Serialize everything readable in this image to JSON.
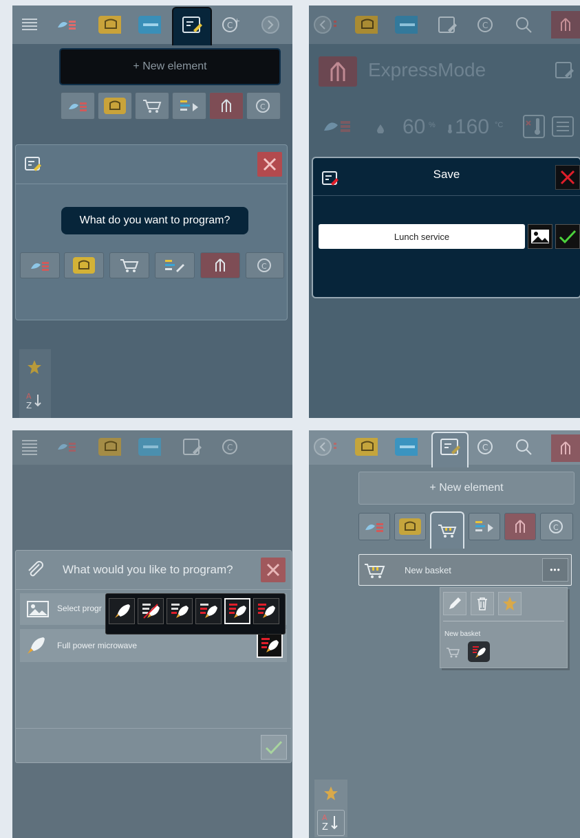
{
  "panel1": {
    "new_element_label": "+ New element",
    "question": "What do you want to program?"
  },
  "panel2": {
    "mode_title": "ExpressMode",
    "humidity_value": "60",
    "humidity_unit": "%",
    "temperature_value": "160",
    "temperature_unit": "°C",
    "dialog_title": "Save",
    "name_value": "Lunch service"
  },
  "panel3": {
    "dialog_title": "What would you like to program?",
    "row1_label": "Select progr",
    "row2_label": "Full power microwave"
  },
  "panel4": {
    "new_element_label": "+ New element",
    "basket_label": "New basket",
    "menu_dots": "•••",
    "popup_caption": "New basket"
  },
  "colors": {
    "navy": "#07253a",
    "red": "#e01e2a",
    "green": "#4cd23c",
    "yellow": "#e8c43a",
    "blue": "#3aa6d6"
  }
}
